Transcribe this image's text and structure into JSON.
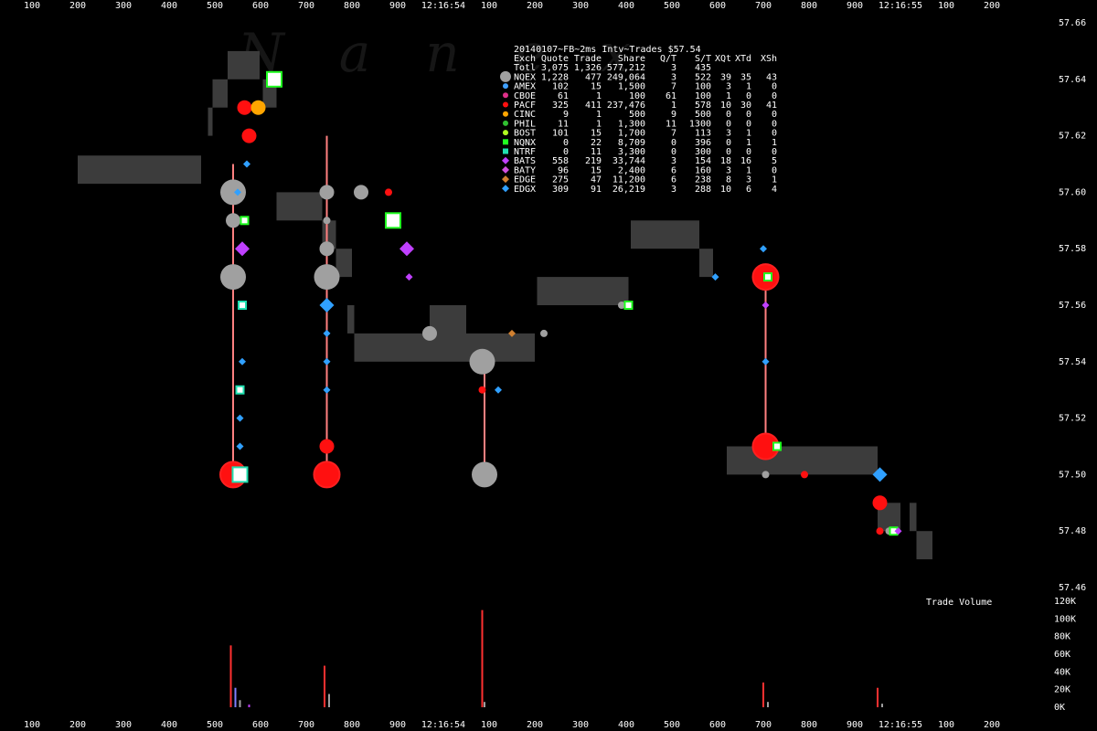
{
  "chart_data": {
    "type": "scatter",
    "title": "20140107~FB~2ms Intv~Trades $57.54",
    "watermark": "Nanex",
    "time_ticks": [
      "100",
      "200",
      "300",
      "400",
      "500",
      "600",
      "700",
      "800",
      "900",
      "12:16:54",
      "100",
      "200",
      "300",
      "400",
      "500",
      "600",
      "700",
      "800",
      "900",
      "12:16:55",
      "100",
      "200"
    ],
    "price_ticks": [
      "57.66",
      "57.64",
      "57.62",
      "57.60",
      "57.58",
      "57.56",
      "57.54",
      "57.52",
      "57.50",
      "57.48",
      "57.46"
    ],
    "ylim": [
      57.46,
      57.66
    ],
    "volume_label": "Trade Volume",
    "volume_ticks": [
      "120K",
      "100K",
      "80K",
      "60K",
      "40K",
      "20K",
      "0K"
    ],
    "table_header": [
      "Exch",
      "Quote",
      "Trade",
      "Share",
      "Q/T",
      "S/T",
      "XQt",
      "XTd",
      "XSh"
    ],
    "table_rows": [
      {
        "exch": "Totl",
        "quote": "3,075",
        "trade": "1,326",
        "share": "577,212",
        "qt": "3",
        "st": "435",
        "xqt": "",
        "xtd": "",
        "xsh": "",
        "marker": "none",
        "color": "#ffffff"
      },
      {
        "exch": "NQEX",
        "quote": "1,228",
        "trade": "477",
        "share": "249,064",
        "qt": "3",
        "st": "522",
        "xqt": "39",
        "xtd": "35",
        "xsh": "43",
        "marker": "big-circle",
        "color": "#a0a0a0"
      },
      {
        "exch": "AMEX",
        "quote": "102",
        "trade": "15",
        "share": "1,500",
        "qt": "7",
        "st": "100",
        "xqt": "3",
        "xtd": "1",
        "xsh": "0",
        "marker": "circle",
        "color": "#3fa0ff"
      },
      {
        "exch": "CBOE",
        "quote": "61",
        "trade": "1",
        "share": "100",
        "qt": "61",
        "st": "100",
        "xqt": "1",
        "xtd": "0",
        "xsh": "0",
        "marker": "circle",
        "color": "#e0308a"
      },
      {
        "exch": "PACF",
        "quote": "325",
        "trade": "411",
        "share": "237,476",
        "qt": "1",
        "st": "578",
        "xqt": "10",
        "xtd": "30",
        "xsh": "41",
        "marker": "circle",
        "color": "#ff1010"
      },
      {
        "exch": "CINC",
        "quote": "9",
        "trade": "1",
        "share": "500",
        "qt": "9",
        "st": "500",
        "xqt": "0",
        "xtd": "0",
        "xsh": "0",
        "marker": "circle",
        "color": "#ffa500"
      },
      {
        "exch": "PHIL",
        "quote": "11",
        "trade": "1",
        "share": "1,300",
        "qt": "11",
        "st": "1300",
        "xqt": "0",
        "xtd": "0",
        "xsh": "0",
        "marker": "circle",
        "color": "#30c030"
      },
      {
        "exch": "BOST",
        "quote": "101",
        "trade": "15",
        "share": "1,700",
        "qt": "7",
        "st": "113",
        "xqt": "3",
        "xtd": "1",
        "xsh": "0",
        "marker": "circle",
        "color": "#b0ff20"
      },
      {
        "exch": "NQNX",
        "quote": "0",
        "trade": "22",
        "share": "8,709",
        "qt": "0",
        "st": "396",
        "xqt": "0",
        "xtd": "1",
        "xsh": "1",
        "marker": "square",
        "color": "#20ff20"
      },
      {
        "exch": "NTRF",
        "quote": "0",
        "trade": "11",
        "share": "3,300",
        "qt": "0",
        "st": "300",
        "xqt": "0",
        "xtd": "0",
        "xsh": "0",
        "marker": "square",
        "color": "#20e0b0"
      },
      {
        "exch": "BATS",
        "quote": "558",
        "trade": "219",
        "share": "33,744",
        "qt": "3",
        "st": "154",
        "xqt": "18",
        "xtd": "16",
        "xsh": "5",
        "marker": "diamond",
        "color": "#c040ff"
      },
      {
        "exch": "BATY",
        "quote": "96",
        "trade": "15",
        "share": "2,400",
        "qt": "6",
        "st": "160",
        "xqt": "3",
        "xtd": "1",
        "xsh": "0",
        "marker": "diamond",
        "color": "#d050e0"
      },
      {
        "exch": "EDGE",
        "quote": "275",
        "trade": "47",
        "share": "11,200",
        "qt": "6",
        "st": "238",
        "xqt": "8",
        "xtd": "3",
        "xsh": "1",
        "marker": "diamond",
        "color": "#d08030"
      },
      {
        "exch": "EDGX",
        "quote": "309",
        "trade": "91",
        "share": "26,219",
        "qt": "3",
        "st": "288",
        "xqt": "10",
        "xtd": "6",
        "xsh": "4",
        "marker": "diamond",
        "color": "#30a0ff"
      }
    ],
    "spread_blocks": [
      {
        "t0": -4.0,
        "t1": -1.3,
        "hi": 57.613,
        "lo": 57.603
      },
      {
        "t0": -1.15,
        "t1": -1.05,
        "hi": 57.63,
        "lo": 57.62
      },
      {
        "t0": -1.05,
        "t1": -0.72,
        "hi": 57.64,
        "lo": 57.63
      },
      {
        "t0": -0.72,
        "t1": -0.02,
        "hi": 57.65,
        "lo": 57.64
      },
      {
        "t0": 0.05,
        "t1": 0.35,
        "hi": 57.64,
        "lo": 57.63
      },
      {
        "t0": 0.35,
        "t1": 1.35,
        "hi": 57.6,
        "lo": 57.59
      },
      {
        "t0": 1.35,
        "t1": 1.65,
        "hi": 57.59,
        "lo": 57.58
      },
      {
        "t0": 1.65,
        "t1": 2.0,
        "hi": 57.58,
        "lo": 57.57
      },
      {
        "t0": 1.9,
        "t1": 2.05,
        "hi": 57.56,
        "lo": 57.55
      },
      {
        "t0": 2.05,
        "t1": 3.7,
        "hi": 57.55,
        "lo": 57.54
      },
      {
        "t0": 3.7,
        "t1": 4.5,
        "hi": 57.56,
        "lo": 57.54
      },
      {
        "t0": 4.5,
        "t1": 6.0,
        "hi": 57.55,
        "lo": 57.54
      },
      {
        "t0": 6.05,
        "t1": 8.05,
        "hi": 57.57,
        "lo": 57.56
      },
      {
        "t0": 8.1,
        "t1": 9.6,
        "hi": 57.59,
        "lo": 57.58
      },
      {
        "t0": 9.6,
        "t1": 9.9,
        "hi": 57.58,
        "lo": 57.57
      },
      {
        "t0": 10.2,
        "t1": 13.5,
        "hi": 57.51,
        "lo": 57.5
      },
      {
        "t0": 13.5,
        "t1": 14.0,
        "hi": 57.49,
        "lo": 57.48
      },
      {
        "t0": 14.2,
        "t1": 14.35,
        "hi": 57.49,
        "lo": 57.48
      },
      {
        "t0": 14.35,
        "t1": 14.7,
        "hi": 57.48,
        "lo": 57.47
      }
    ],
    "price_bursts": [
      {
        "t": -0.6,
        "top": 57.61,
        "bottom": 57.5
      },
      {
        "t": 1.45,
        "top": 57.62,
        "bottom": 57.5
      },
      {
        "t": 4.9,
        "top": 57.54,
        "bottom": 57.5
      },
      {
        "t": 11.05,
        "top": 57.57,
        "bottom": 57.51
      }
    ],
    "trade_points": [
      {
        "t": -0.6,
        "p": 57.6,
        "exch": "NQEX",
        "size": "big"
      },
      {
        "t": -0.6,
        "p": 57.59,
        "exch": "NQEX",
        "size": "mid"
      },
      {
        "t": -0.6,
        "p": 57.57,
        "exch": "NQEX",
        "size": "big"
      },
      {
        "t": -0.6,
        "p": 57.5,
        "exch": "PACF",
        "size": "big"
      },
      {
        "t": -0.45,
        "p": 57.5,
        "exch": "NTRF",
        "size": "mid"
      },
      {
        "t": -0.5,
        "p": 57.6,
        "exch": "EDGX",
        "size": "small"
      },
      {
        "t": -0.4,
        "p": 57.58,
        "exch": "BATS",
        "size": "mid"
      },
      {
        "t": -0.35,
        "p": 57.59,
        "exch": "NQNX",
        "size": "small"
      },
      {
        "t": -0.4,
        "p": 57.54,
        "exch": "EDGX",
        "size": "small"
      },
      {
        "t": -0.45,
        "p": 57.52,
        "exch": "EDGX",
        "size": "small"
      },
      {
        "t": -0.45,
        "p": 57.53,
        "exch": "NTRF",
        "size": "small"
      },
      {
        "t": -0.4,
        "p": 57.56,
        "exch": "NTRF",
        "size": "small"
      },
      {
        "t": -0.45,
        "p": 57.51,
        "exch": "EDGX",
        "size": "small"
      },
      {
        "t": -0.3,
        "p": 57.61,
        "exch": "EDGX",
        "size": "small"
      },
      {
        "t": -0.25,
        "p": 57.62,
        "exch": "PACF",
        "size": "mid"
      },
      {
        "t": -0.35,
        "p": 57.63,
        "exch": "PACF",
        "size": "mid"
      },
      {
        "t": -0.05,
        "p": 57.63,
        "exch": "CINC",
        "size": "mid"
      },
      {
        "t": 0.3,
        "p": 57.64,
        "exch": "NQNX",
        "size": "mid"
      },
      {
        "t": 1.45,
        "p": 57.6,
        "exch": "NQEX",
        "size": "mid"
      },
      {
        "t": 1.45,
        "p": 57.59,
        "exch": "NQEX",
        "size": "small"
      },
      {
        "t": 1.45,
        "p": 57.58,
        "exch": "NQEX",
        "size": "mid"
      },
      {
        "t": 1.45,
        "p": 57.57,
        "exch": "NQEX",
        "size": "big"
      },
      {
        "t": 1.45,
        "p": 57.56,
        "exch": "EDGX",
        "size": "mid"
      },
      {
        "t": 1.45,
        "p": 57.55,
        "exch": "EDGX",
        "size": "small"
      },
      {
        "t": 1.45,
        "p": 57.54,
        "exch": "EDGX",
        "size": "small"
      },
      {
        "t": 1.45,
        "p": 57.53,
        "exch": "EDGX",
        "size": "small"
      },
      {
        "t": 1.45,
        "p": 57.51,
        "exch": "PACF",
        "size": "mid"
      },
      {
        "t": 1.45,
        "p": 57.5,
        "exch": "PACF",
        "size": "big"
      },
      {
        "t": 2.2,
        "p": 57.6,
        "exch": "NQEX",
        "size": "mid"
      },
      {
        "t": 2.8,
        "p": 57.6,
        "exch": "PACF",
        "size": "small"
      },
      {
        "t": 2.9,
        "p": 57.59,
        "exch": "NQNX",
        "size": "mid"
      },
      {
        "t": 3.2,
        "p": 57.58,
        "exch": "BATS",
        "size": "mid"
      },
      {
        "t": 3.25,
        "p": 57.57,
        "exch": "BATS",
        "size": "small"
      },
      {
        "t": 3.7,
        "p": 57.55,
        "exch": "NQEX",
        "size": "mid"
      },
      {
        "t": 4.85,
        "p": 57.54,
        "exch": "NQEX",
        "size": "big"
      },
      {
        "t": 4.85,
        "p": 57.53,
        "exch": "PACF",
        "size": "small"
      },
      {
        "t": 4.9,
        "p": 57.5,
        "exch": "NQEX",
        "size": "big"
      },
      {
        "t": 5.2,
        "p": 57.53,
        "exch": "EDGX",
        "size": "small"
      },
      {
        "t": 5.5,
        "p": 57.55,
        "exch": "EDGE",
        "size": "small"
      },
      {
        "t": 6.2,
        "p": 57.55,
        "exch": "NQEX",
        "size": "small"
      },
      {
        "t": 7.9,
        "p": 57.56,
        "exch": "NQEX",
        "size": "small"
      },
      {
        "t": 8.05,
        "p": 57.56,
        "exch": "NQNX",
        "size": "small"
      },
      {
        "t": 9.95,
        "p": 57.57,
        "exch": "EDGX",
        "size": "small"
      },
      {
        "t": 11.0,
        "p": 57.58,
        "exch": "EDGX",
        "size": "small"
      },
      {
        "t": 11.05,
        "p": 57.57,
        "exch": "PACF",
        "size": "big"
      },
      {
        "t": 11.1,
        "p": 57.57,
        "exch": "NQNX",
        "size": "small"
      },
      {
        "t": 11.05,
        "p": 57.56,
        "exch": "BATS",
        "size": "small"
      },
      {
        "t": 11.05,
        "p": 57.54,
        "exch": "EDGX",
        "size": "small"
      },
      {
        "t": 11.05,
        "p": 57.51,
        "exch": "PACF",
        "size": "big"
      },
      {
        "t": 11.3,
        "p": 57.51,
        "exch": "NQNX",
        "size": "small"
      },
      {
        "t": 11.05,
        "p": 57.5,
        "exch": "NQEX",
        "size": "small"
      },
      {
        "t": 11.9,
        "p": 57.5,
        "exch": "PACF",
        "size": "small"
      },
      {
        "t": 13.55,
        "p": 57.5,
        "exch": "EDGX",
        "size": "mid"
      },
      {
        "t": 13.55,
        "p": 57.49,
        "exch": "PACF",
        "size": "mid"
      },
      {
        "t": 13.55,
        "p": 57.48,
        "exch": "PACF",
        "size": "small"
      },
      {
        "t": 13.75,
        "p": 57.48,
        "exch": "NQEX",
        "size": "small"
      },
      {
        "t": 13.85,
        "p": 57.48,
        "exch": "NQNX",
        "size": "small"
      },
      {
        "t": 13.95,
        "p": 57.48,
        "exch": "BATS",
        "size": "small"
      }
    ],
    "volume_bars": [
      {
        "t": -0.65,
        "v": 70000,
        "color": "#ff3030"
      },
      {
        "t": -0.55,
        "v": 22000,
        "color": "#8080ff"
      },
      {
        "t": -0.45,
        "v": 8000,
        "color": "#a0a0a0"
      },
      {
        "t": -0.25,
        "v": 3000,
        "color": "#c040ff"
      },
      {
        "t": 1.4,
        "v": 47000,
        "color": "#ff3030"
      },
      {
        "t": 1.5,
        "v": 15000,
        "color": "#a0a0a0"
      },
      {
        "t": 4.85,
        "v": 110000,
        "color": "#ff3030"
      },
      {
        "t": 4.9,
        "v": 6000,
        "color": "#a0a0a0"
      },
      {
        "t": 11.0,
        "v": 28000,
        "color": "#ff3030"
      },
      {
        "t": 11.1,
        "v": 6000,
        "color": "#a0a0a0"
      },
      {
        "t": 13.5,
        "v": 22000,
        "color": "#ff3030"
      },
      {
        "t": 13.6,
        "v": 4000,
        "color": "#a0a0a0"
      }
    ],
    "volume_ylim": [
      0,
      120000
    ],
    "xlim": [
      -5,
      16
    ],
    "grid": false,
    "colors": {
      "background": "#000000",
      "spread": "#3c3c3c",
      "burst": "#ff8080",
      "axis_text": "#ffffff"
    }
  }
}
